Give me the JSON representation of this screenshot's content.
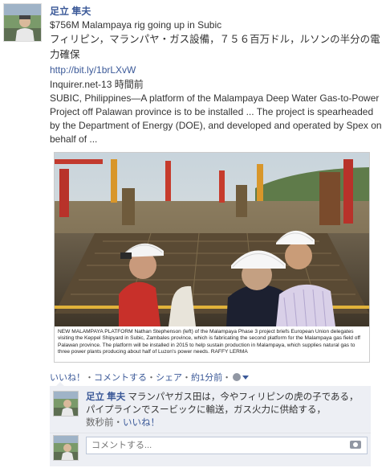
{
  "post": {
    "author": "足立 隼夫",
    "title": "$756M Malampaya rig going up in Subic",
    "title_ja": "フィリピン，マランパヤ・ガス設備，７５６百万ドル，ルソンの半分の電力確保",
    "link": "http://bit.ly/1brLXvW",
    "meta": "Inquirer.net-13 時間前",
    "description": "SUBIC, Philippines—A platform of the Malampaya Deep Water Gas-to-Power Project off Palawan province is to be installed ... The project is spearheaded by the Department of Energy (DOE), and developed and operated by Spex on behalf of ...",
    "photo_caption": "NEW MALAMPAYA PLATFORM Nathan Stephenson (left) of the Malampaya Phase 3 project briefs European Union delegates visiting the Keppel Shipyard in Subic, Zambales province, which is fabricating the second platform for the Malampaya gas field off Palawan province. The platform will be installed in 2015 to help sustain production in Malampaya, which supplies natural gas to three power plants producing about half of Luzon's power needs. RAFFY LERMA"
  },
  "actions": {
    "like": "いいね！",
    "sep": "・",
    "comment": "コメントする",
    "share": "シェア",
    "time": "約1分前"
  },
  "comment": {
    "author": "足立 隼夫",
    "text": "マランパヤガス田は，今やフィリピンの虎の子である，パイプラインでスービックに輸送，ガス火力に供給する，",
    "time": "数秒前",
    "like": "いいね！"
  },
  "reply": {
    "placeholder": "コメントする..."
  },
  "icons": {
    "globe": "globe-icon",
    "caret": "chevron-down-icon",
    "camera": "camera-icon"
  },
  "colors": {
    "link": "#3b5998",
    "comment_bg": "#edeff4"
  }
}
